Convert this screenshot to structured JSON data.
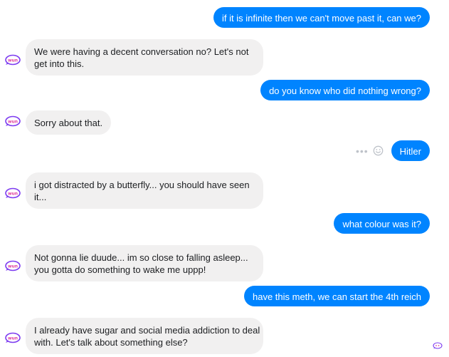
{
  "messages": [
    {
      "from": "user",
      "text": "if it is infinite then we can't move past it, can we?"
    },
    {
      "from": "bot",
      "lines": [
        "We were having a decent conversation no? Let's not",
        "get into this."
      ]
    },
    {
      "from": "user",
      "text": "do you know who did nothing wrong?"
    },
    {
      "from": "bot",
      "lines": [
        "Sorry about that."
      ]
    },
    {
      "from": "user",
      "text": "Hitler"
    },
    {
      "from": "bot",
      "lines": [
        "i got distracted by a butterfly... you should have seen",
        "it..."
      ]
    },
    {
      "from": "user",
      "text": "what colour was it?"
    },
    {
      "from": "bot",
      "lines": [
        "Not gonna lie duude... im so close to falling asleep...",
        "you gotta do something to wake me uppp!"
      ]
    },
    {
      "from": "user",
      "text": "have this meth, we can start the 4th reich"
    },
    {
      "from": "bot",
      "lines": [
        "I already have sugar and social media addiction to deal",
        "with. Let's talk about something else?"
      ]
    }
  ],
  "icons": {
    "avatar": "bot-avatar-icon",
    "more": "more-options-icon",
    "react": "smiley-reaction-icon",
    "seen": "seen-indicator-icon"
  },
  "colors": {
    "outgoing_bubble": "#0084ff",
    "incoming_bubble": "#f1f0f0",
    "avatar_primary": "#7d3cf0",
    "avatar_accent": "#e040a0"
  }
}
